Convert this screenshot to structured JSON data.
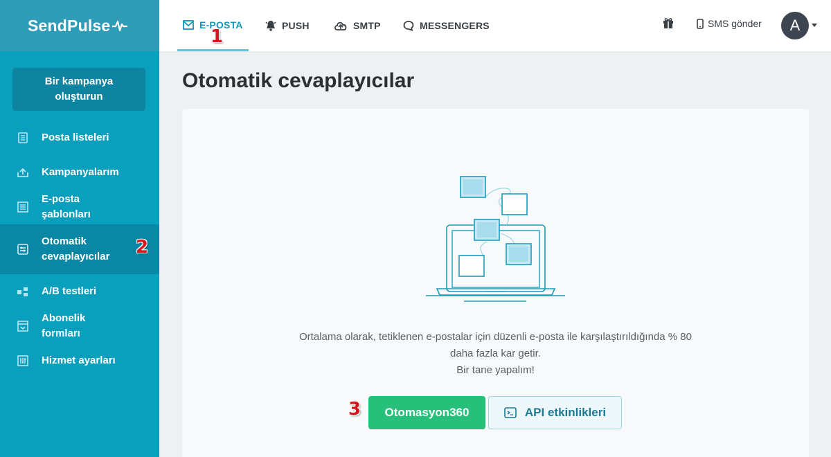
{
  "brand": {
    "name": "SendPulse"
  },
  "sidebar": {
    "create_button": "Bir kampanya oluşturun",
    "items": [
      {
        "label": "Posta listeleri",
        "icon": "list-icon"
      },
      {
        "label": "Kampanyalarım",
        "icon": "campaigns-icon"
      },
      {
        "label": "E-posta şablonları",
        "icon": "templates-icon"
      },
      {
        "label": "Otomatik cevaplayıcılar",
        "icon": "autoresponder-icon",
        "active": true
      },
      {
        "label": "A/B testleri",
        "icon": "ab-test-icon"
      },
      {
        "label": "Abonelik formları",
        "icon": "forms-icon"
      },
      {
        "label": "Hizmet ayarları",
        "icon": "settings-icon"
      }
    ]
  },
  "topbar": {
    "tabs": [
      {
        "label": "E-POSTA",
        "icon": "mail-icon",
        "active": true
      },
      {
        "label": "PUSH",
        "icon": "bell-icon"
      },
      {
        "label": "SMTP",
        "icon": "cloud-icon"
      },
      {
        "label": "MESSENGERS",
        "icon": "chat-icon"
      }
    ],
    "gift_icon": "gift-icon",
    "sms_label": "SMS gönder",
    "avatar_letter": "A"
  },
  "main": {
    "title": "Otomatik cevaplayıcılar",
    "description": [
      "Ortalama olarak, tetiklenen e-postalar için düzenli e-posta ile karşılaştırıldığında % 80",
      "daha fazla kar getir.",
      "Bir tane yapalım!"
    ],
    "primary_button": "Otomasyon360",
    "secondary_button": "API etkinlikleri"
  },
  "annotations": [
    "1",
    "2",
    "3"
  ],
  "colors": {
    "sidebar": "#0a9fbd",
    "accent": "#1396b8",
    "primary_button": "#27c07b",
    "marker": "#d61920"
  }
}
